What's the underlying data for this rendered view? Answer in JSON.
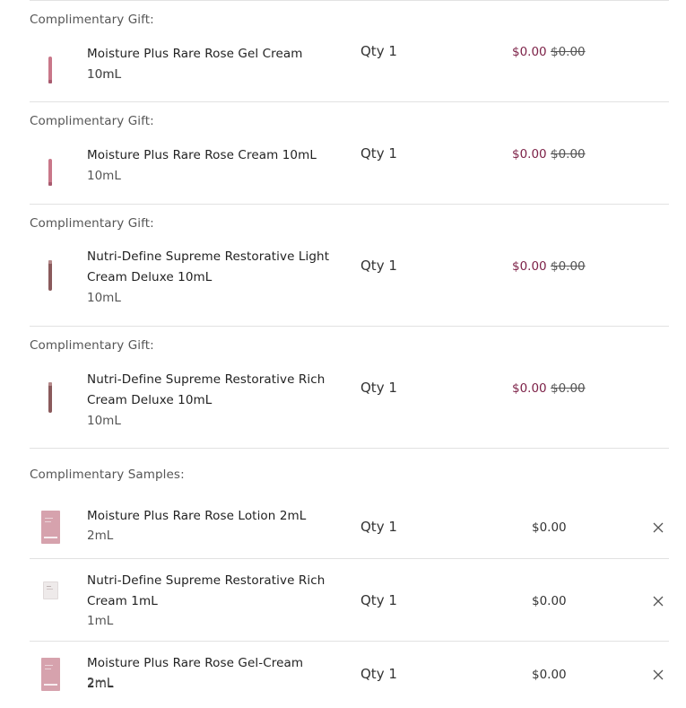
{
  "colors": {
    "sale_price": "#7d2248",
    "rose_tube": "#c97789",
    "define_tube": "#8a5a5c",
    "sachet": "#d6a2ad"
  },
  "gifts": [
    {
      "section_label": "Complimentary Gift:",
      "name": "Moisture Plus Rare Rose Gel Cream 10mL",
      "size": "10mL",
      "qty": "Qty 1",
      "price": "$0.00",
      "original_price": "$0.00",
      "thumb_icon": "rose-tube-icon"
    },
    {
      "section_label": "Complimentary Gift:",
      "name": "Moisture Plus Rare Rose Cream 10mL",
      "size": "10mL",
      "qty": "Qty 1",
      "price": "$0.00",
      "original_price": "$0.00",
      "thumb_icon": "rose-tube-icon"
    },
    {
      "section_label": "Complimentary Gift:",
      "name": "Nutri-Define Supreme Restorative Light Cream Deluxe 10mL",
      "size": "10mL",
      "qty": "Qty 1",
      "price": "$0.00",
      "original_price": "$0.00",
      "thumb_icon": "define-tube-icon"
    },
    {
      "section_label": "Complimentary Gift:",
      "name": "Nutri-Define Supreme Restorative Rich Cream Deluxe 10mL",
      "size": "10mL",
      "qty": "Qty 1",
      "price": "$0.00",
      "original_price": "$0.00",
      "thumb_icon": "define-tube-icon"
    }
  ],
  "samples": {
    "section_label": "Complimentary Samples:",
    "items": [
      {
        "name": "Moisture Plus Rare Rose Lotion 2mL",
        "size": "2mL",
        "qty": "Qty 1",
        "price": "$0.00",
        "thumb_icon": "rose-sachet-icon",
        "remove_icon": "close-icon"
      },
      {
        "name": "Nutri-Define Supreme Restorative Rich Cream 1mL",
        "size": "1mL",
        "qty": "Qty 1",
        "price": "$0.00",
        "thumb_icon": "white-sachet-icon",
        "remove_icon": "close-icon"
      },
      {
        "name": "Moisture Plus Rare Rose Gel-Cream 2mL",
        "size": "2mL",
        "qty": "Qty 1",
        "price": "$0.00",
        "thumb_icon": "rose-sachet-icon",
        "remove_icon": "close-icon"
      }
    ]
  }
}
